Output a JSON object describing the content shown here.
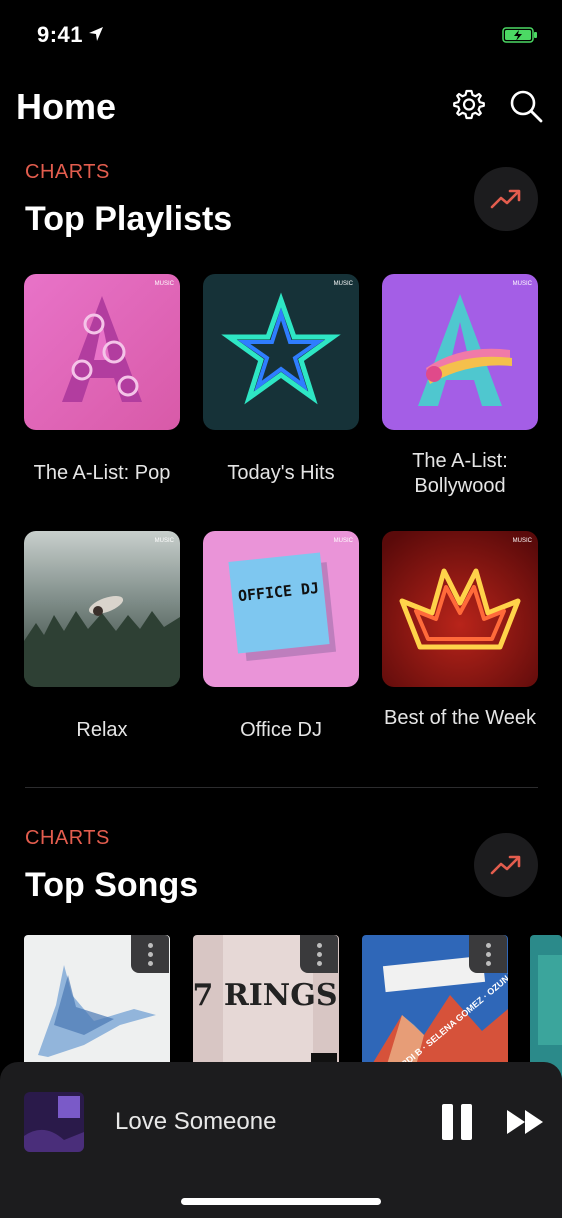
{
  "status": {
    "time": "9:41"
  },
  "header": {
    "title": "Home"
  },
  "sections": [
    {
      "kicker": "CHARTS",
      "title": "Top Playlists"
    },
    {
      "kicker": "CHARTS",
      "title": "Top Songs"
    }
  ],
  "playlists": [
    {
      "label": "The A-List: Pop",
      "badge": "MUSIC"
    },
    {
      "label": "Today's Hits",
      "badge": "MUSIC"
    },
    {
      "label": "The A-List: Bollywood",
      "badge": "MUSIC"
    },
    {
      "label": "Relax",
      "badge": "MUSIC"
    },
    {
      "label": "Office DJ",
      "badge": "MUSIC",
      "art_text": "OFFICE DJ"
    },
    {
      "label": "Best of the Week",
      "badge": "MUSIC"
    }
  ],
  "songs": [
    {
      "art_text": ""
    },
    {
      "art_text": "7 RINGS"
    },
    {
      "art_text": "DJ SNAKE · CARDI B · SELENA GOMEZ · OZUNA"
    }
  ],
  "player": {
    "title": "Love Someone"
  },
  "colors": {
    "accent": "#e35d4e",
    "background": "#000000",
    "player_bg": "#1c1c1e"
  },
  "icons": [
    "location-arrow-icon",
    "battery-icon",
    "gear-icon",
    "search-icon",
    "trending-icon",
    "more-icon",
    "pause-icon",
    "fast-forward-icon"
  ]
}
